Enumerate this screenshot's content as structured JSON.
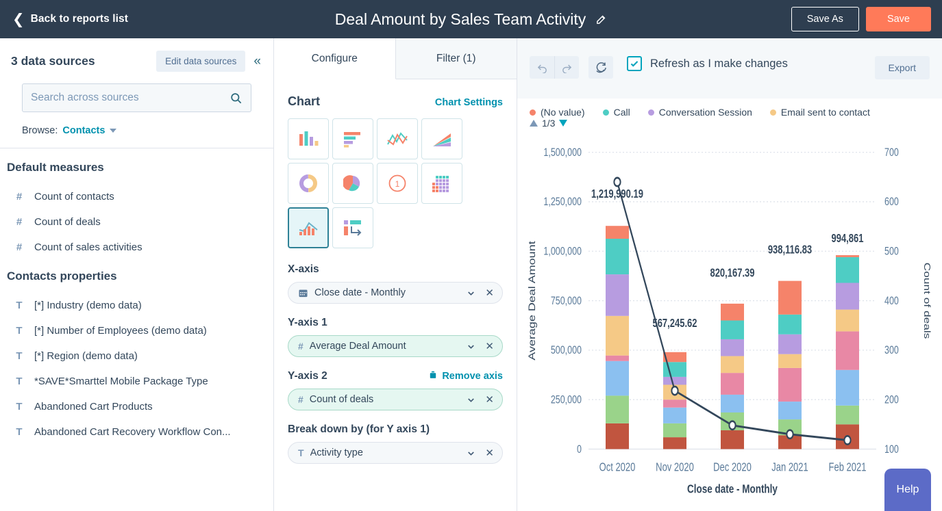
{
  "topbar": {
    "back_label": "Back to reports list",
    "back_icon": "chevron-left-icon",
    "title": "Deal Amount by Sales Team Activity",
    "edit_icon": "pencil-icon",
    "save_as_label": "Save As",
    "save_label": "Save",
    "save_color": "#ff7a59",
    "bg_color": "#2e3e50"
  },
  "sidebar": {
    "sources_title": "3 data sources",
    "edit_sources_label": "Edit data sources",
    "collapse_icon": "chevron-double-left-icon",
    "search_placeholder": "Search across sources",
    "search_value": "",
    "search_icon": "search-icon",
    "browse_label": "Browse:",
    "browse_value": "Contacts",
    "sections": [
      {
        "title": "Default measures",
        "items": [
          {
            "type": "#",
            "label": "Count of contacts"
          },
          {
            "type": "#",
            "label": "Count of deals"
          },
          {
            "type": "#",
            "label": "Count of sales activities"
          }
        ]
      },
      {
        "title": "Contacts properties",
        "items": [
          {
            "type": "T",
            "label": "[*] Industry (demo data)"
          },
          {
            "type": "T",
            "label": "[*] Number of Employees (demo data)"
          },
          {
            "type": "T",
            "label": "[*] Region (demo data)"
          },
          {
            "type": "T",
            "label": "*SAVE*Smarttel Mobile Package Type"
          },
          {
            "type": "T",
            "label": "Abandoned Cart Products"
          },
          {
            "type": "T",
            "label": "Abandoned Cart Recovery Workflow Con..."
          }
        ]
      }
    ]
  },
  "configure": {
    "tabs": [
      {
        "label": "Configure",
        "active": true
      },
      {
        "label": "Filter (1)",
        "active": false
      }
    ],
    "chart_heading": "Chart",
    "chart_settings_link": "Chart Settings",
    "chart_types": [
      {
        "name": "vertical-bar-chart-icon",
        "selected": false
      },
      {
        "name": "horizontal-bar-chart-icon",
        "selected": false
      },
      {
        "name": "line-chart-icon",
        "selected": false
      },
      {
        "name": "area-chart-icon",
        "selected": false
      },
      {
        "name": "donut-chart-icon",
        "selected": false
      },
      {
        "name": "pie-chart-icon",
        "selected": false
      },
      {
        "name": "single-value-icon",
        "selected": false
      },
      {
        "name": "heatmap-icon",
        "selected": false
      },
      {
        "name": "combo-chart-icon",
        "selected": true
      },
      {
        "name": "pivot-table-icon",
        "selected": false
      }
    ],
    "fields": [
      {
        "label": "X-axis",
        "icon": "calendar-icon",
        "icon_glyph": "▦",
        "value": "Close date - Monthly",
        "style": "grey",
        "action": null
      },
      {
        "label": "Y-axis 1",
        "icon": "number-icon",
        "icon_glyph": "#",
        "value": "Average Deal Amount",
        "style": "green",
        "action": null
      },
      {
        "label": "Y-axis 2",
        "icon": "number-icon",
        "icon_glyph": "#",
        "value": "Count of deals",
        "style": "green",
        "action": {
          "label": "Remove axis",
          "icon": "trash-icon"
        }
      },
      {
        "label": "Break down by (for Y axis 1)",
        "icon": "text-icon",
        "icon_glyph": "T",
        "value": "Activity type",
        "style": "grey",
        "action": null
      }
    ]
  },
  "toolbar": {
    "undo_icon": "undo-icon",
    "redo_icon": "redo-icon",
    "refresh_icon": "refresh-icon",
    "refresh_checkbox_checked": true,
    "refresh_label": "Refresh as I make changes",
    "export_label": "Export",
    "accent_color": "#00a4bd"
  },
  "chart_data": {
    "type": "bar",
    "title": "",
    "xlabel": "Close date - Monthly",
    "ylabel": "Average Deal Amount",
    "y2label": "Count of deals",
    "categories": [
      "Oct 2020",
      "Nov 2020",
      "Dec 2020",
      "Jan 2021",
      "Feb 2021"
    ],
    "ylim": [
      0,
      1500000
    ],
    "yticks": [
      "0",
      "250,000",
      "500,000",
      "750,000",
      "1,000,000",
      "1,250,000",
      "1,500,000"
    ],
    "y2lim": [
      100,
      700
    ],
    "y2ticks": [
      "100",
      "200",
      "300",
      "400",
      "500",
      "600",
      "700"
    ],
    "grid": true,
    "legend_position": "top",
    "legend": [
      {
        "label": "(No value)",
        "color": "#f5836a"
      },
      {
        "label": "Call",
        "color": "#4ecdc4"
      },
      {
        "label": "Conversation Session",
        "color": "#b79ce0"
      },
      {
        "label": "Email sent to contact",
        "color": "#f5c986"
      }
    ],
    "legend_pager": "1/3",
    "bar_totals": [
      "1,219,990.19",
      "567,245.62",
      "820,167.39",
      "938,116.83",
      "994,861"
    ],
    "bar_total_values": [
      1219990.19,
      567245.62,
      820167.39,
      938116.83,
      994861
    ],
    "stacked_series": [
      {
        "name": "segment-1-brown",
        "color": "#c1553f",
        "values": [
          130000,
          60000,
          95000,
          70000,
          125000
        ]
      },
      {
        "name": "segment-2-green",
        "color": "#9ad38a",
        "values": [
          140000,
          70000,
          90000,
          80000,
          95000
        ]
      },
      {
        "name": "segment-3-blue",
        "color": "#8bc0f0",
        "values": [
          175000,
          80000,
          90000,
          90000,
          180000
        ]
      },
      {
        "name": "segment-4-pink",
        "color": "#e888a5",
        "values": [
          28000,
          40000,
          110000,
          170000,
          195000
        ]
      },
      {
        "name": "segment-5-orange",
        "color": "#f5c986",
        "values": [
          200000,
          75000,
          85000,
          70000,
          110000
        ]
      },
      {
        "name": "segment-6-purple",
        "color": "#b79ce0",
        "values": [
          210000,
          40000,
          85000,
          100000,
          135000
        ]
      },
      {
        "name": "segment-7-teal",
        "color": "#4ecdc4",
        "values": [
          180000,
          75000,
          95000,
          100000,
          130000
        ]
      },
      {
        "name": "segment-8-coral",
        "color": "#f5836a",
        "values": [
          65000,
          50000,
          85000,
          170000,
          10000
        ]
      }
    ],
    "line_series": {
      "name": "Count of deals",
      "color": "#33475b",
      "values": [
        640,
        218,
        148,
        130,
        118
      ],
      "marker": "circle"
    }
  },
  "help": {
    "label": "Help",
    "color": "#5c6bc7"
  }
}
